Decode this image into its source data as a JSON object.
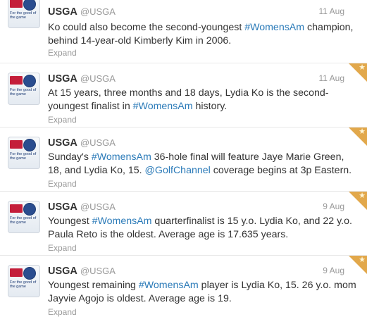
{
  "tweets": [
    {
      "name": "USGA",
      "handle": "@USGA",
      "time": "11 Aug",
      "text": [
        {
          "t": "Ko could also become the second-youngest ",
          "k": "text"
        },
        {
          "t": "#WomensAm",
          "k": "hashtag"
        },
        {
          "t": " champion, behind 14-year-old Kimberly Kim in 2006.",
          "k": "text"
        }
      ],
      "expand": "Expand",
      "favorited": false,
      "avatar_tagline": "For the good of the game"
    },
    {
      "name": "USGA",
      "handle": "@USGA",
      "time": "11 Aug",
      "text": [
        {
          "t": "At 15 years, three months and 18 days, Lydia Ko is the second-youngest finalist in ",
          "k": "text"
        },
        {
          "t": "#WomensAm",
          "k": "hashtag"
        },
        {
          "t": " history.",
          "k": "text"
        }
      ],
      "expand": "Expand",
      "favorited": true,
      "avatar_tagline": "For the good of the game"
    },
    {
      "name": "USGA",
      "handle": "@USGA",
      "time": "",
      "text": [
        {
          "t": "Sunday's ",
          "k": "text"
        },
        {
          "t": "#WomensAm",
          "k": "hashtag"
        },
        {
          "t": " 36-hole final will feature Jaye Marie Green, 18, and Lydia Ko, 15. ",
          "k": "text"
        },
        {
          "t": "@GolfChannel",
          "k": "mention"
        },
        {
          "t": " coverage begins at 3p Eastern.",
          "k": "text"
        }
      ],
      "expand": "Expand",
      "favorited": true,
      "avatar_tagline": "For the good of the game"
    },
    {
      "name": "USGA",
      "handle": "@USGA",
      "time": "9 Aug",
      "text": [
        {
          "t": "Youngest ",
          "k": "text"
        },
        {
          "t": "#WomensAm",
          "k": "hashtag"
        },
        {
          "t": " quarterfinalist is 15 y.o. Lydia Ko, and 22 y.o. Paula Reto is the oldest. Average age is 17.635 years.",
          "k": "text"
        }
      ],
      "expand": "Expand",
      "favorited": true,
      "avatar_tagline": "For the good of the game"
    },
    {
      "name": "USGA",
      "handle": "@USGA",
      "time": "9 Aug",
      "text": [
        {
          "t": "Youngest remaining ",
          "k": "text"
        },
        {
          "t": "#WomensAm",
          "k": "hashtag"
        },
        {
          "t": " player is Lydia Ko, 15. 26 y.o. mom Jayvie Agojo is oldest. Average age is 19.",
          "k": "text"
        }
      ],
      "expand": "Expand",
      "favorited": true,
      "avatar_tagline": "For the good of the game"
    }
  ],
  "colors": {
    "link": "#2a7ab8",
    "favorite": "#e2a84b",
    "usga_red": "#c41e3a",
    "usga_blue": "#2a4d8f"
  },
  "icons": {
    "favorite": "star-icon",
    "avatar": "usga-logo-icon"
  }
}
